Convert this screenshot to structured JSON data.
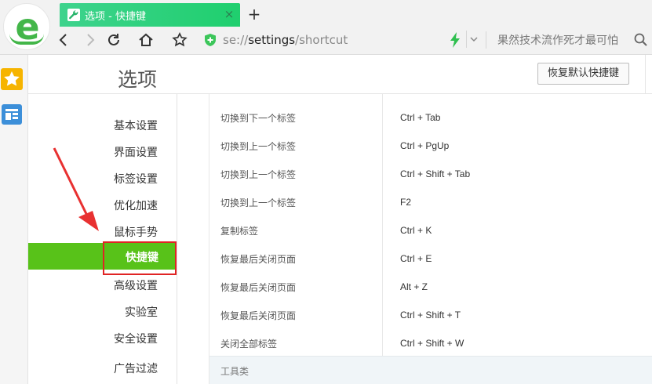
{
  "browser": {
    "tab_title": "选项 - 快捷键",
    "tab_close": "×",
    "new_tab": "+",
    "url_prefix": "se://",
    "url_host": "settings",
    "url_path": "/shortcut",
    "search_text": "果然技术流作死才最可怕"
  },
  "header": {
    "title": "选项",
    "restore_label": "恢复默认快捷键"
  },
  "nav": {
    "items": [
      "基本设置",
      "界面设置",
      "标签设置",
      "优化加速",
      "鼠标手势",
      "快捷键",
      "高级设置",
      "实验室",
      "安全设置",
      "广告过滤"
    ],
    "active_index": 5
  },
  "shortcuts": {
    "rows": [
      {
        "name": "切换到下一个标签",
        "key": "Ctrl + Tab"
      },
      {
        "name": "切换到上一个标签",
        "key": "Ctrl + PgUp"
      },
      {
        "name": "切换到上一个标签",
        "key": "Ctrl + Shift + Tab"
      },
      {
        "name": "切换到上一个标签",
        "key": "F2"
      },
      {
        "name": "复制标签",
        "key": "Ctrl + K"
      },
      {
        "name": "恢复最后关闭页面",
        "key": "Ctrl + E"
      },
      {
        "name": "恢复最后关闭页面",
        "key": "Alt + Z"
      },
      {
        "name": "恢复最后关闭页面",
        "key": "Ctrl + Shift + T"
      },
      {
        "name": "关闭全部标签",
        "key": "Ctrl + Shift + W"
      }
    ],
    "next_section": "工具类"
  },
  "colors": {
    "active_nav": "#58c219",
    "tab_green": "#1fcf6e",
    "highlight_red": "#e02424"
  }
}
